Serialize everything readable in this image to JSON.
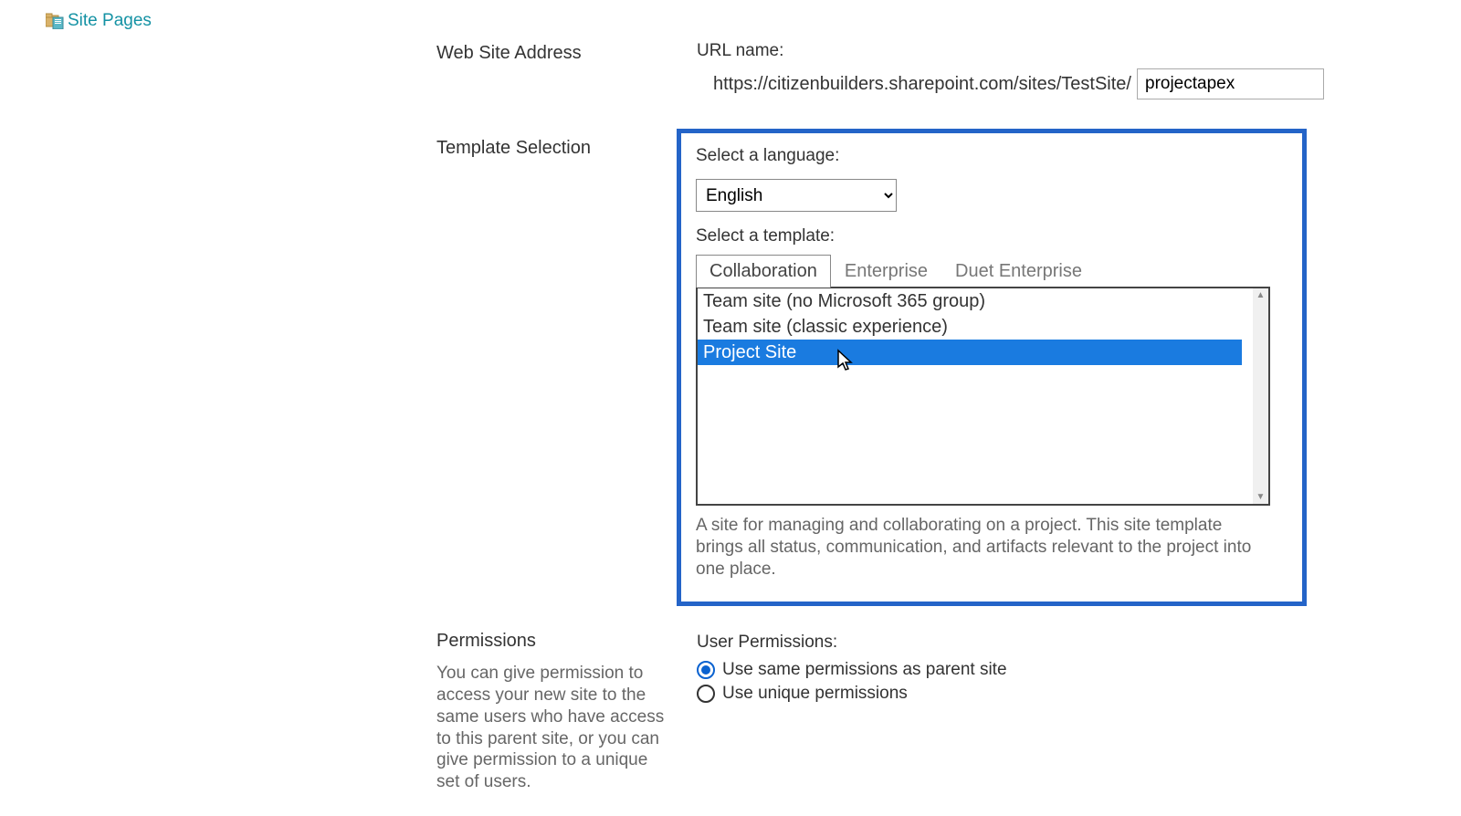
{
  "sidebar": {
    "site_pages_label": "Site Pages"
  },
  "address": {
    "section_label": "Web Site Address",
    "url_label": "URL name:",
    "url_prefix": "https://citizenbuilders.sharepoint.com/sites/TestSite/",
    "url_value": "projectapex"
  },
  "template": {
    "section_label": "Template Selection",
    "lang_label": "Select a language:",
    "lang_value": "English",
    "template_label": "Select a template:",
    "tabs": [
      "Collaboration",
      "Enterprise",
      "Duet Enterprise"
    ],
    "options": [
      "Team site (no Microsoft 365 group)",
      "Team site (classic experience)",
      "Project Site"
    ],
    "description": "A site for managing and collaborating on a project. This site template brings all status, communication, and artifacts relevant to the project into one place."
  },
  "permissions": {
    "section_label": "Permissions",
    "description": "You can give permission to access your new site to the same users who have access to this parent site, or you can give permission to a unique set of users.",
    "user_perm_label": "User Permissions:",
    "option_same": "Use same permissions as parent site",
    "option_unique": "Use unique permissions"
  }
}
